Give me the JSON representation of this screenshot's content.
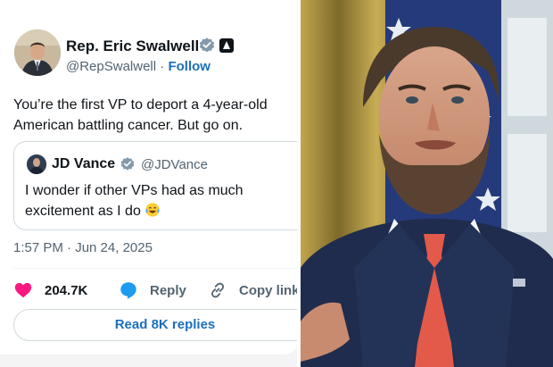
{
  "tweet": {
    "author_name": "Rep. Eric Swalwell",
    "author_handle": "@RepSwalwell",
    "separator": "·",
    "follow_label": "Follow",
    "text": "You’re the first VP to deport a 4-year-old American battling cancer. But go on.",
    "timestamp": "1:57 PM · Jun 24, 2025",
    "likes": "204.7K",
    "reply_label": "Reply",
    "copy_label": "Copy link",
    "read_replies_label": "Read 8K replies"
  },
  "quote": {
    "author_name": "JD Vance",
    "author_handle": "@JDVance",
    "text": "I wonder if other VPs had as much excitement as I do"
  },
  "icons": {
    "verified": "verified-badge-icon",
    "government": "government-badge-icon",
    "emoji": "laughing-crying-emoji",
    "like": "heart-icon",
    "reply": "reply-bubble-icon",
    "copy": "link-icon"
  },
  "colors": {
    "accent_blue": "#1d6fbb",
    "verified_gray": "#829aab",
    "like_pink": "#f91880",
    "reply_blue": "#1d9bf0",
    "text_primary": "#0f1419",
    "text_secondary": "#536471"
  }
}
